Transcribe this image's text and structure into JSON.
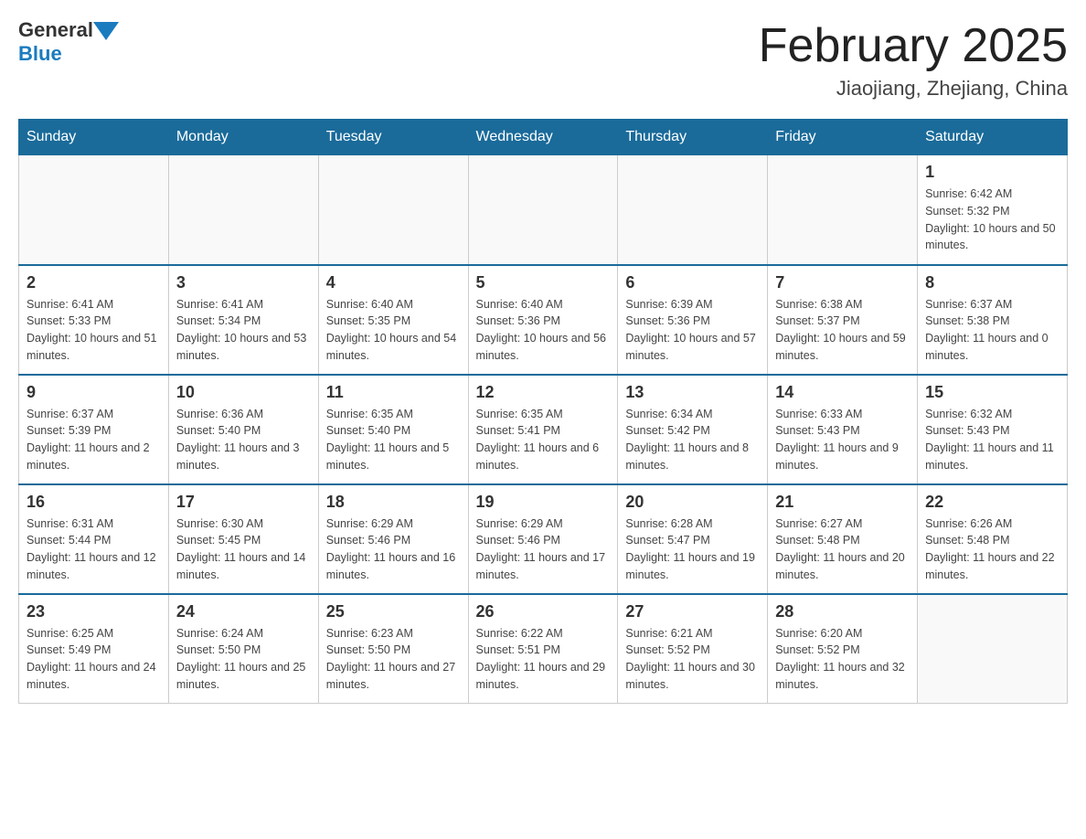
{
  "header": {
    "logo_general": "General",
    "logo_blue": "Blue",
    "title": "February 2025",
    "location": "Jiaojiang, Zhejiang, China"
  },
  "weekdays": [
    "Sunday",
    "Monday",
    "Tuesday",
    "Wednesday",
    "Thursday",
    "Friday",
    "Saturday"
  ],
  "rows": [
    [
      {
        "day": "",
        "sunrise": "",
        "sunset": "",
        "daylight": ""
      },
      {
        "day": "",
        "sunrise": "",
        "sunset": "",
        "daylight": ""
      },
      {
        "day": "",
        "sunrise": "",
        "sunset": "",
        "daylight": ""
      },
      {
        "day": "",
        "sunrise": "",
        "sunset": "",
        "daylight": ""
      },
      {
        "day": "",
        "sunrise": "",
        "sunset": "",
        "daylight": ""
      },
      {
        "day": "",
        "sunrise": "",
        "sunset": "",
        "daylight": ""
      },
      {
        "day": "1",
        "sunrise": "Sunrise: 6:42 AM",
        "sunset": "Sunset: 5:32 PM",
        "daylight": "Daylight: 10 hours and 50 minutes."
      }
    ],
    [
      {
        "day": "2",
        "sunrise": "Sunrise: 6:41 AM",
        "sunset": "Sunset: 5:33 PM",
        "daylight": "Daylight: 10 hours and 51 minutes."
      },
      {
        "day": "3",
        "sunrise": "Sunrise: 6:41 AM",
        "sunset": "Sunset: 5:34 PM",
        "daylight": "Daylight: 10 hours and 53 minutes."
      },
      {
        "day": "4",
        "sunrise": "Sunrise: 6:40 AM",
        "sunset": "Sunset: 5:35 PM",
        "daylight": "Daylight: 10 hours and 54 minutes."
      },
      {
        "day": "5",
        "sunrise": "Sunrise: 6:40 AM",
        "sunset": "Sunset: 5:36 PM",
        "daylight": "Daylight: 10 hours and 56 minutes."
      },
      {
        "day": "6",
        "sunrise": "Sunrise: 6:39 AM",
        "sunset": "Sunset: 5:36 PM",
        "daylight": "Daylight: 10 hours and 57 minutes."
      },
      {
        "day": "7",
        "sunrise": "Sunrise: 6:38 AM",
        "sunset": "Sunset: 5:37 PM",
        "daylight": "Daylight: 10 hours and 59 minutes."
      },
      {
        "day": "8",
        "sunrise": "Sunrise: 6:37 AM",
        "sunset": "Sunset: 5:38 PM",
        "daylight": "Daylight: 11 hours and 0 minutes."
      }
    ],
    [
      {
        "day": "9",
        "sunrise": "Sunrise: 6:37 AM",
        "sunset": "Sunset: 5:39 PM",
        "daylight": "Daylight: 11 hours and 2 minutes."
      },
      {
        "day": "10",
        "sunrise": "Sunrise: 6:36 AM",
        "sunset": "Sunset: 5:40 PM",
        "daylight": "Daylight: 11 hours and 3 minutes."
      },
      {
        "day": "11",
        "sunrise": "Sunrise: 6:35 AM",
        "sunset": "Sunset: 5:40 PM",
        "daylight": "Daylight: 11 hours and 5 minutes."
      },
      {
        "day": "12",
        "sunrise": "Sunrise: 6:35 AM",
        "sunset": "Sunset: 5:41 PM",
        "daylight": "Daylight: 11 hours and 6 minutes."
      },
      {
        "day": "13",
        "sunrise": "Sunrise: 6:34 AM",
        "sunset": "Sunset: 5:42 PM",
        "daylight": "Daylight: 11 hours and 8 minutes."
      },
      {
        "day": "14",
        "sunrise": "Sunrise: 6:33 AM",
        "sunset": "Sunset: 5:43 PM",
        "daylight": "Daylight: 11 hours and 9 minutes."
      },
      {
        "day": "15",
        "sunrise": "Sunrise: 6:32 AM",
        "sunset": "Sunset: 5:43 PM",
        "daylight": "Daylight: 11 hours and 11 minutes."
      }
    ],
    [
      {
        "day": "16",
        "sunrise": "Sunrise: 6:31 AM",
        "sunset": "Sunset: 5:44 PM",
        "daylight": "Daylight: 11 hours and 12 minutes."
      },
      {
        "day": "17",
        "sunrise": "Sunrise: 6:30 AM",
        "sunset": "Sunset: 5:45 PM",
        "daylight": "Daylight: 11 hours and 14 minutes."
      },
      {
        "day": "18",
        "sunrise": "Sunrise: 6:29 AM",
        "sunset": "Sunset: 5:46 PM",
        "daylight": "Daylight: 11 hours and 16 minutes."
      },
      {
        "day": "19",
        "sunrise": "Sunrise: 6:29 AM",
        "sunset": "Sunset: 5:46 PM",
        "daylight": "Daylight: 11 hours and 17 minutes."
      },
      {
        "day": "20",
        "sunrise": "Sunrise: 6:28 AM",
        "sunset": "Sunset: 5:47 PM",
        "daylight": "Daylight: 11 hours and 19 minutes."
      },
      {
        "day": "21",
        "sunrise": "Sunrise: 6:27 AM",
        "sunset": "Sunset: 5:48 PM",
        "daylight": "Daylight: 11 hours and 20 minutes."
      },
      {
        "day": "22",
        "sunrise": "Sunrise: 6:26 AM",
        "sunset": "Sunset: 5:48 PM",
        "daylight": "Daylight: 11 hours and 22 minutes."
      }
    ],
    [
      {
        "day": "23",
        "sunrise": "Sunrise: 6:25 AM",
        "sunset": "Sunset: 5:49 PM",
        "daylight": "Daylight: 11 hours and 24 minutes."
      },
      {
        "day": "24",
        "sunrise": "Sunrise: 6:24 AM",
        "sunset": "Sunset: 5:50 PM",
        "daylight": "Daylight: 11 hours and 25 minutes."
      },
      {
        "day": "25",
        "sunrise": "Sunrise: 6:23 AM",
        "sunset": "Sunset: 5:50 PM",
        "daylight": "Daylight: 11 hours and 27 minutes."
      },
      {
        "day": "26",
        "sunrise": "Sunrise: 6:22 AM",
        "sunset": "Sunset: 5:51 PM",
        "daylight": "Daylight: 11 hours and 29 minutes."
      },
      {
        "day": "27",
        "sunrise": "Sunrise: 6:21 AM",
        "sunset": "Sunset: 5:52 PM",
        "daylight": "Daylight: 11 hours and 30 minutes."
      },
      {
        "day": "28",
        "sunrise": "Sunrise: 6:20 AM",
        "sunset": "Sunset: 5:52 PM",
        "daylight": "Daylight: 11 hours and 32 minutes."
      },
      {
        "day": "",
        "sunrise": "",
        "sunset": "",
        "daylight": ""
      }
    ]
  ]
}
